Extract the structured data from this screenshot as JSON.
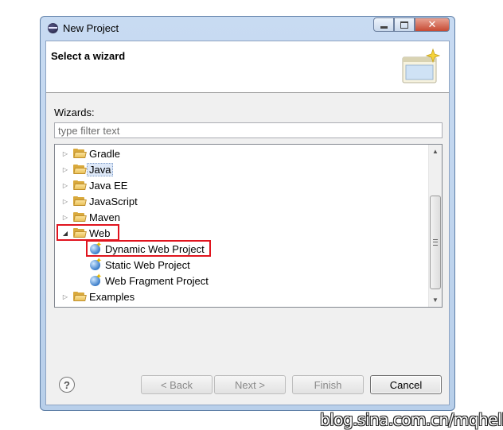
{
  "window": {
    "title": "New Project",
    "close_glyph": "✕"
  },
  "banner": {
    "title": "Select a wizard",
    "image_icon": "wizard-banner-icon"
  },
  "wizards": {
    "label": "Wizards:",
    "filter_placeholder": "type filter text"
  },
  "tree": {
    "items": [
      {
        "label": "Gradle",
        "type": "folder",
        "expanded": false
      },
      {
        "label": "Java",
        "type": "folder",
        "expanded": false,
        "selected": true
      },
      {
        "label": "Java EE",
        "type": "folder",
        "expanded": false
      },
      {
        "label": "JavaScript",
        "type": "folder",
        "expanded": false
      },
      {
        "label": "Maven",
        "type": "folder",
        "expanded": false
      },
      {
        "label": "Web",
        "type": "folder",
        "expanded": true
      },
      {
        "label": "Dynamic Web Project",
        "type": "project",
        "child": true
      },
      {
        "label": "Static Web Project",
        "type": "project",
        "child": true
      },
      {
        "label": "Web Fragment Project",
        "type": "project",
        "child": true
      },
      {
        "label": "Examples",
        "type": "folder",
        "expanded": false
      }
    ]
  },
  "buttons": {
    "help": "?",
    "back": "< Back",
    "next": "Next >",
    "finish": "Finish",
    "cancel": "Cancel"
  },
  "watermark": "blog.sina.com.cn/mqhello",
  "colors": {
    "highlight": "#e0141e",
    "selection": "#dde8f8"
  }
}
